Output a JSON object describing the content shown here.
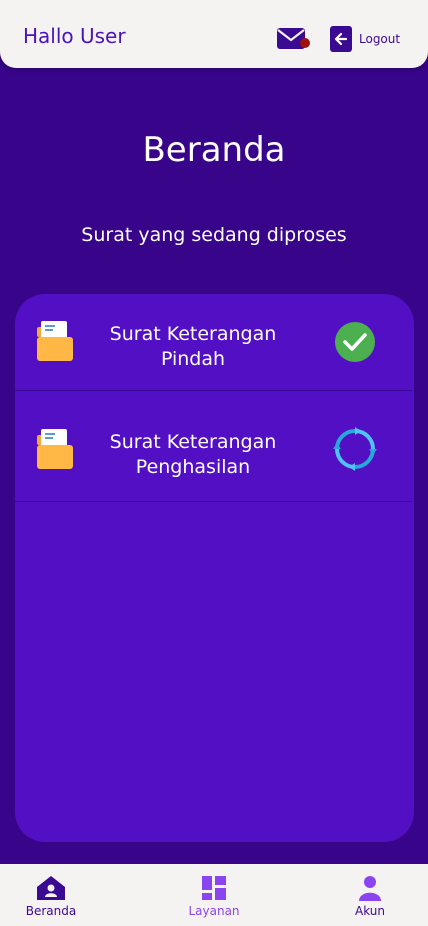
{
  "header": {
    "greeting": "Hallo User",
    "logout_label": "Logout",
    "mail_icon": "mail-icon",
    "logout_icon": "arrow-left-icon"
  },
  "main": {
    "title": "Beranda",
    "subtitle": "Surat yang sedang diproses",
    "letters": [
      {
        "title_line1": "Surat Keterangan",
        "title_line2": "Pindah",
        "status": "completed",
        "status_icon": "check-circle-icon",
        "icon": "folder-document-icon"
      },
      {
        "title_line1": "Surat Keterangan",
        "title_line2": "Penghasilan",
        "status": "in-progress",
        "status_icon": "loading-refresh-icon",
        "icon": "folder-document-icon"
      }
    ]
  },
  "bottom_nav": {
    "items": [
      {
        "label": "Beranda",
        "icon": "home-icon",
        "active": true
      },
      {
        "label": "Layanan",
        "icon": "grid-icon",
        "active": false
      },
      {
        "label": "Akun",
        "icon": "user-icon",
        "active": false
      }
    ]
  },
  "colors": {
    "background": "#38058a",
    "card": "#520fc4",
    "accent": "#4b14b8",
    "success": "#4caf50",
    "nav_inactive": "#8b45f0"
  }
}
